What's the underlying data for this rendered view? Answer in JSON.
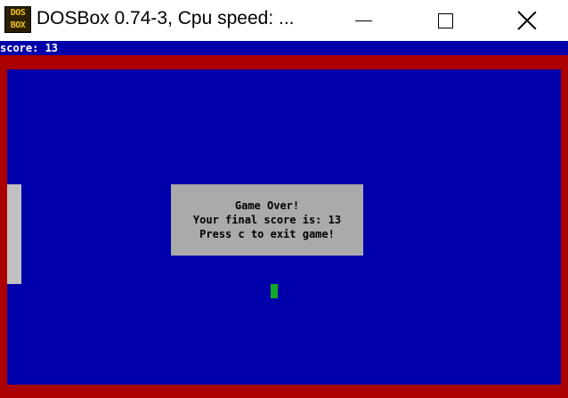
{
  "window": {
    "title": "DOSBox 0.74-3, Cpu speed:  ...",
    "icon_label_top": "DOS",
    "icon_label_bottom": "BOX",
    "icon": "dosbox-icon",
    "controls": {
      "minimize_icon": "minimize-icon",
      "maximize_icon": "maximize-icon",
      "close_icon": "close-icon"
    }
  },
  "game": {
    "score_text": "score: 13",
    "dialog": {
      "line1": "Game Over!",
      "line2": "Your final score is: 13",
      "line3": "Press c to exit game!"
    }
  },
  "colors": {
    "background": "#0000aa",
    "border": "#aa0000",
    "paddle": "#c0c0c0",
    "ball": "#11aa22",
    "dialog": "#aaaaaa",
    "text": "#ffffff"
  }
}
